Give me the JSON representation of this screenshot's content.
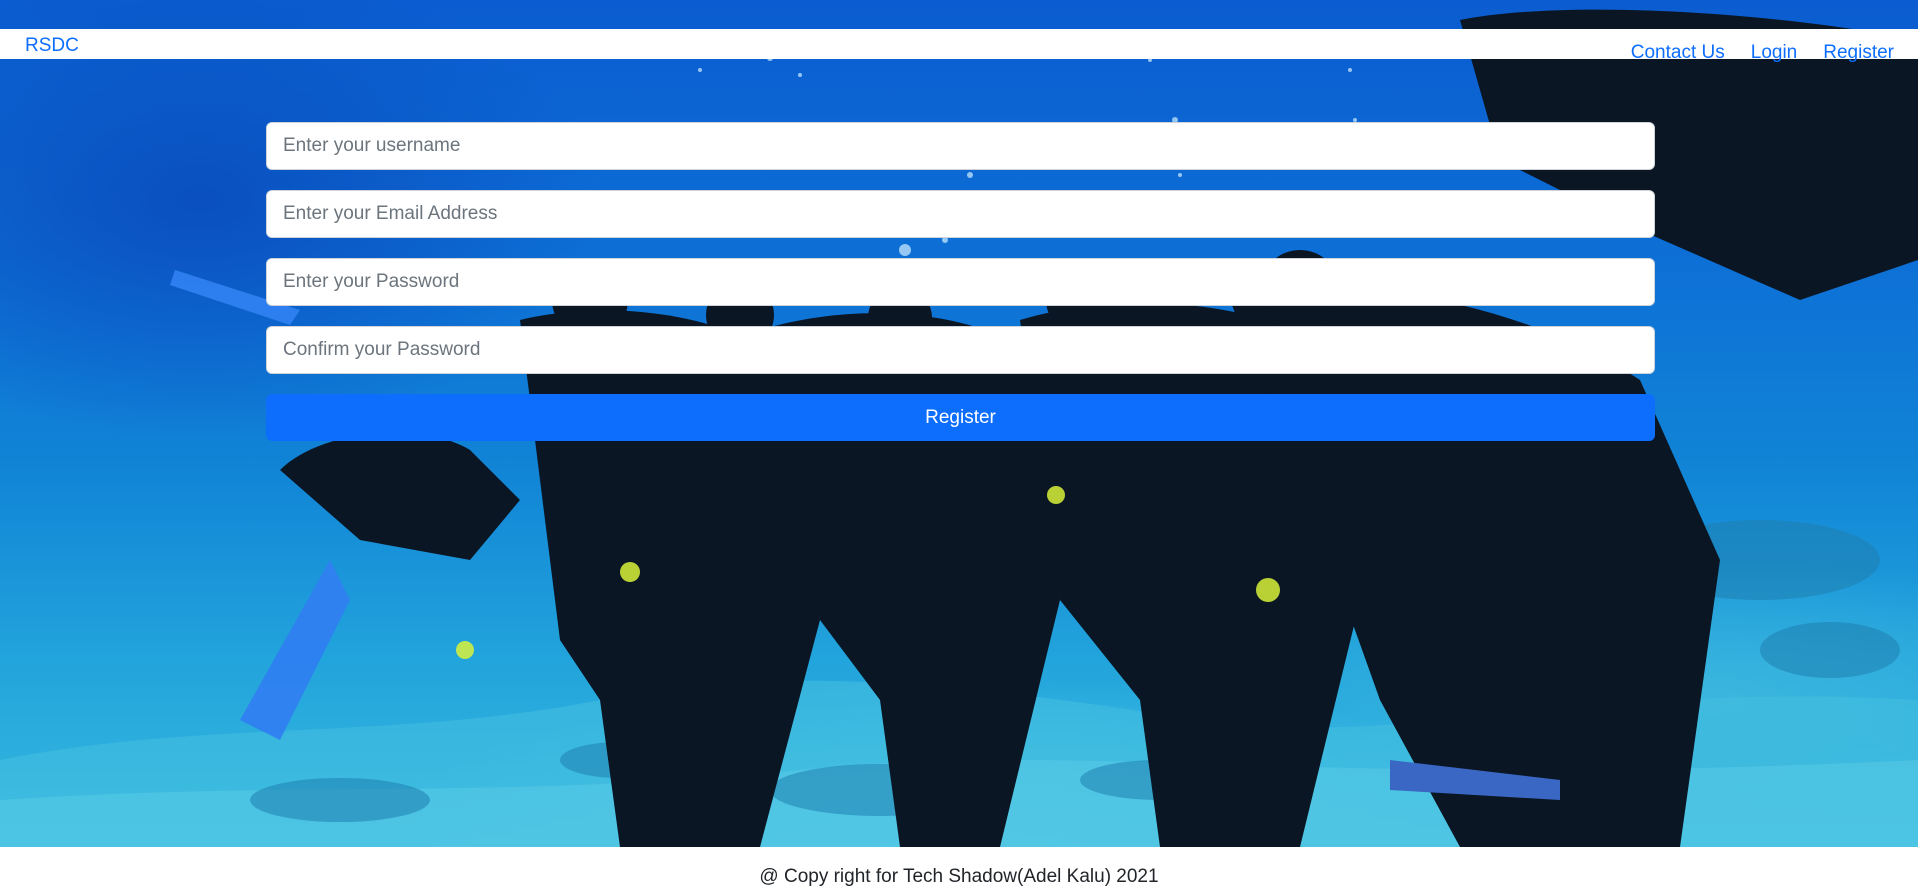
{
  "navbar": {
    "brand": "RSDC",
    "links": [
      {
        "label": "Contact Us"
      },
      {
        "label": "Login"
      },
      {
        "label": "Register"
      }
    ]
  },
  "hero": {
    "image": "underwater-scuba-divers-group-photo"
  },
  "form": {
    "username": {
      "placeholder": "Enter your username",
      "value": ""
    },
    "email": {
      "placeholder": "Enter your Email Address",
      "value": ""
    },
    "password": {
      "placeholder": "Enter your Password",
      "value": ""
    },
    "confirm_password": {
      "placeholder": "Confirm your Password",
      "value": ""
    },
    "submit_label": "Register"
  },
  "footer": {
    "text": "@ Copy right for Tech Shadow(Adel Kalu) 2021"
  },
  "colors": {
    "accent": "#0d6efd",
    "water_deep": "#0b5cd0",
    "water_light": "#37badf"
  }
}
